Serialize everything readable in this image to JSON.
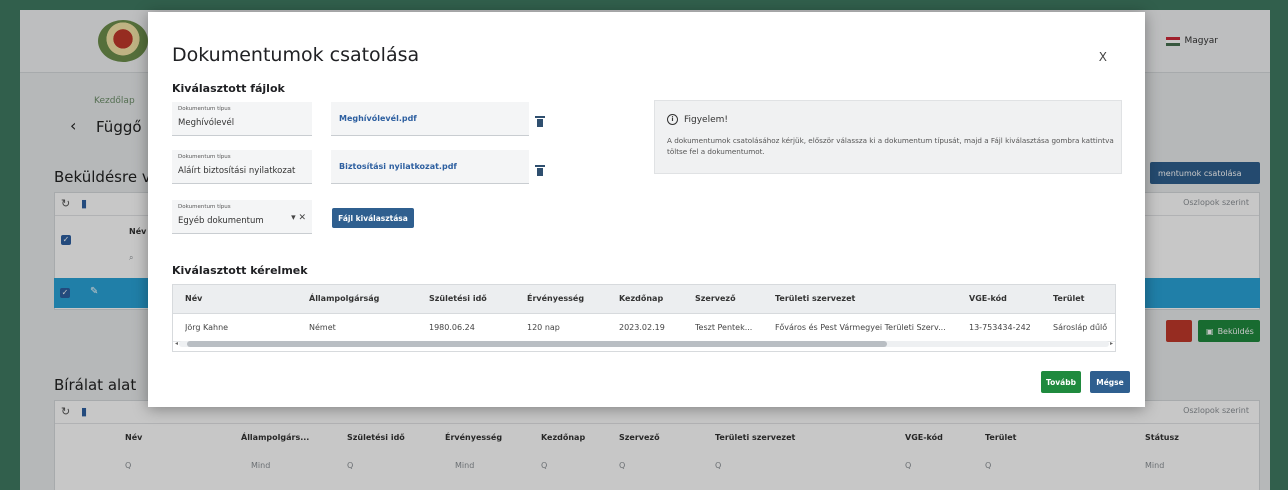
{
  "background": {
    "language": "Magyar",
    "breadcrumb": "Kezdőlap",
    "page_title": "Függő",
    "section1_title": "Beküldésre vá",
    "section2_title": "Bírálat alat",
    "attach_button": "mentumok csatolása",
    "submit_button": "Beküldés",
    "reject_button": "",
    "column_settings_link": "Oszlopok szerint",
    "table1_col": "Név",
    "table2_columns": [
      "Név",
      "Állampolgárs...",
      "Születési idő",
      "Érvényesség",
      "Kezdőnap",
      "Szervező",
      "Területi szervezet",
      "VGE-kód",
      "Terület",
      "Státusz"
    ],
    "filter_placeholders": [
      "Q",
      "Mind",
      "Q",
      "Mind",
      "Q",
      "Q",
      "Q",
      "Q",
      "Q",
      "Mind"
    ]
  },
  "modal": {
    "title": "Dokumentumok csatolása",
    "close_label": "X",
    "selected_files_title": "Kiválasztott fájlok",
    "doc_type_label": "Dokumentum típus",
    "documents": [
      {
        "type": "Meghívólevél",
        "file": "Meghívólevél.pdf"
      },
      {
        "type": "Aláírt biztosítási nyilatkozat",
        "file": "Biztosítási nyilatkozat.pdf"
      }
    ],
    "new_doc_type_value": "Egyéb dokumentum",
    "select_file_button": "Fájl kiválasztása",
    "info": {
      "heading": "Figyelem!",
      "text": "A dokumentumok csatolásához kérjük, először válassza ki a dokumentum típusát, majd a Fájl kiválasztása gombra kattintva töltse fel a dokumentumot."
    },
    "requests_title": "Kiválasztott kérelmek",
    "columns": [
      "Név",
      "Állampolgárság",
      "Születési idő",
      "Érvényesség",
      "Kezdőnap",
      "Szervező",
      "Területi szervezet",
      "VGE-kód",
      "Terület"
    ],
    "rows": [
      [
        "Jörg Kahne",
        "Német",
        "1980.06.24",
        "120 nap",
        "2023.02.19",
        "Teszt Pentek...",
        "Főváros és Pest Vármegyei Területi Szerv...",
        "13-753434-242",
        "Sárosláp dűlő"
      ]
    ],
    "next_button": "Tovább",
    "cancel_button": "Mégse"
  },
  "colors": {
    "primary": "#2f5f8f",
    "success": "#1f8a3e",
    "frame": "#3f7a62",
    "link": "#2d5fa0"
  }
}
